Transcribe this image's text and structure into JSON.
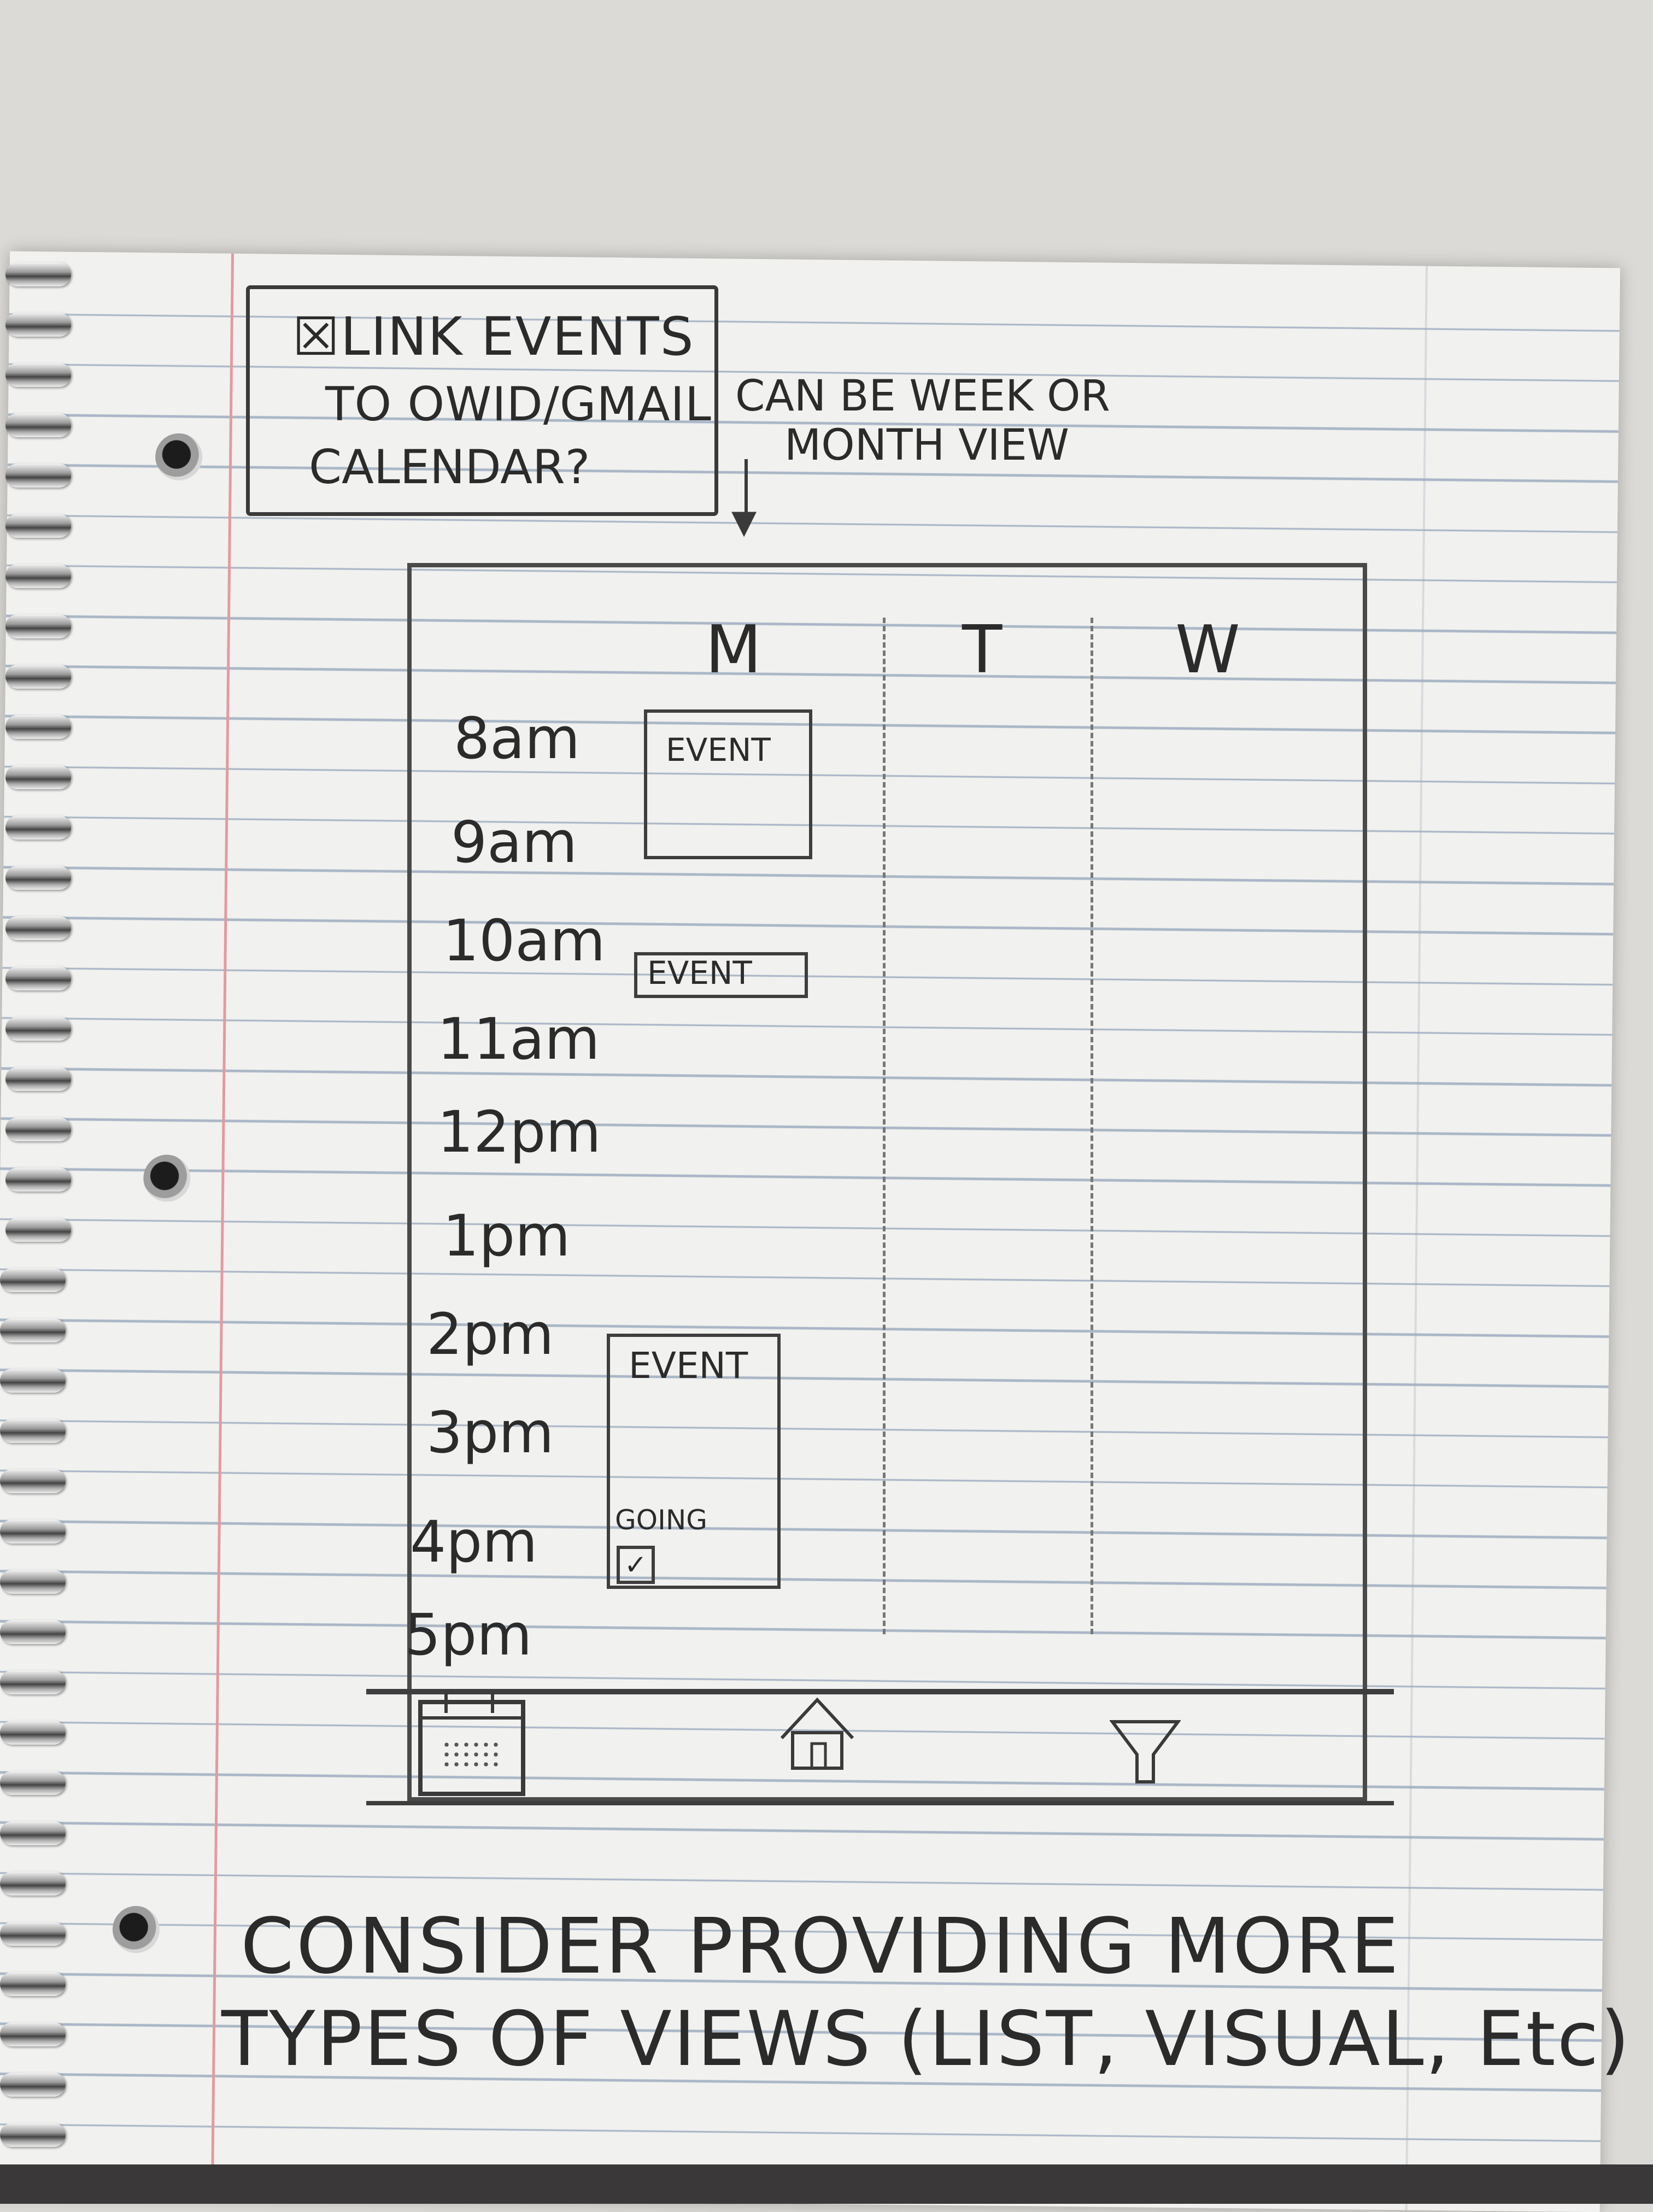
{
  "notes": {
    "boxed_note": [
      "☒LINK EVENTS",
      "TO OWID/GMAIL",
      "CALENDAR?"
    ],
    "side_note": [
      "CAN BE WEEK OR",
      "MONTH VIEW"
    ],
    "bottom_note": [
      "CONSIDER PROVIDING MORE",
      "TYPES OF VIEWS (LIST, VISUAL, Etc)"
    ]
  },
  "calendar": {
    "days": [
      "M",
      "T",
      "W"
    ],
    "times": [
      "8am",
      "9am",
      "10am",
      "11am",
      "12pm",
      "1pm",
      "2pm",
      "3pm",
      "4pm",
      "5pm"
    ],
    "events": [
      {
        "label": "EVENT"
      },
      {
        "label": "EVENT"
      },
      {
        "label": "EVENT",
        "rsvp_label": "GOING",
        "rsvp_checked": true
      }
    ]
  },
  "nav": {
    "icons": [
      "calendar-icon",
      "home-icon",
      "filter-icon"
    ],
    "selected": "calendar-icon"
  },
  "colors": {
    "paper": "#f1f1ef",
    "rule_line": "#a9b6c6",
    "margin_line": "#e39aa0",
    "pencil": "#2b2b2b"
  }
}
